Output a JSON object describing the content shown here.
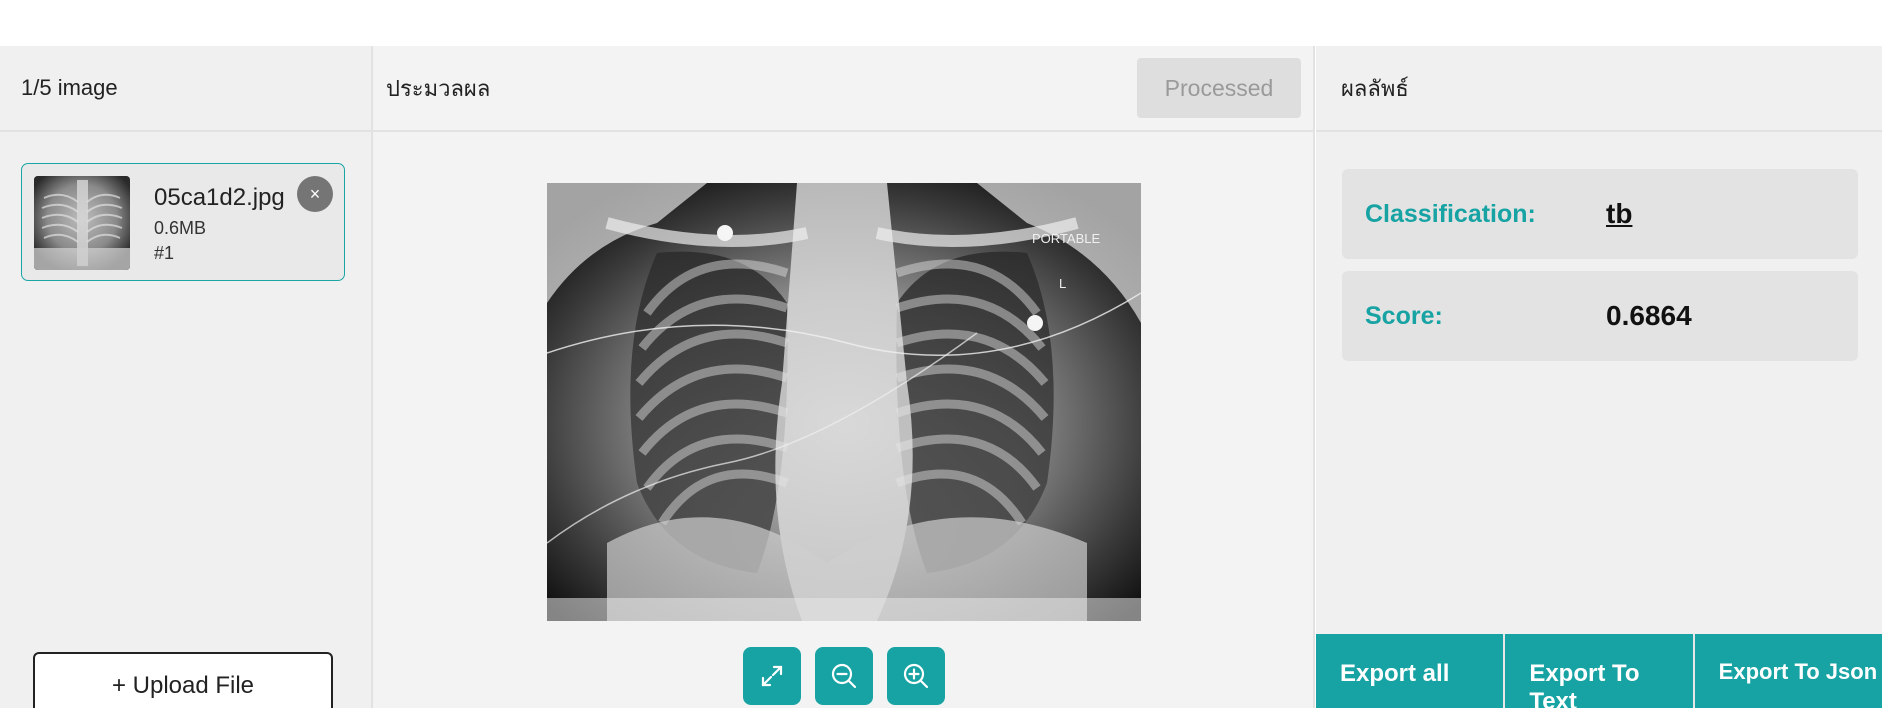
{
  "left_panel": {
    "title": "1/5 image",
    "file": {
      "name": "05ca1d2.jpg",
      "size": "0.6MB",
      "index": "#1",
      "remove_glyph": "×"
    },
    "upload_label": "+ Upload File"
  },
  "middle_panel": {
    "title": "ประมวลผล",
    "processed_label": "Processed",
    "xray": {
      "text_portable": "PORTABLE",
      "text_side": "L"
    },
    "tools": [
      {
        "icon": "expand-icon"
      },
      {
        "icon": "zoom-out-icon"
      },
      {
        "icon": "zoom-in-icon"
      }
    ]
  },
  "right_panel": {
    "title": "ผลลัพธ์",
    "classification_label": "Classification:",
    "classification_value": "tb",
    "score_label": "Score:",
    "score_value": "0.6864",
    "exports": [
      "Export all",
      "Export To Text",
      "Export To Json"
    ]
  },
  "colors": {
    "accent": "#17a3a3",
    "panel_bg": "#f0f0f0",
    "row_bg": "#e3e3e3",
    "button_disabled_bg": "#dedede"
  }
}
